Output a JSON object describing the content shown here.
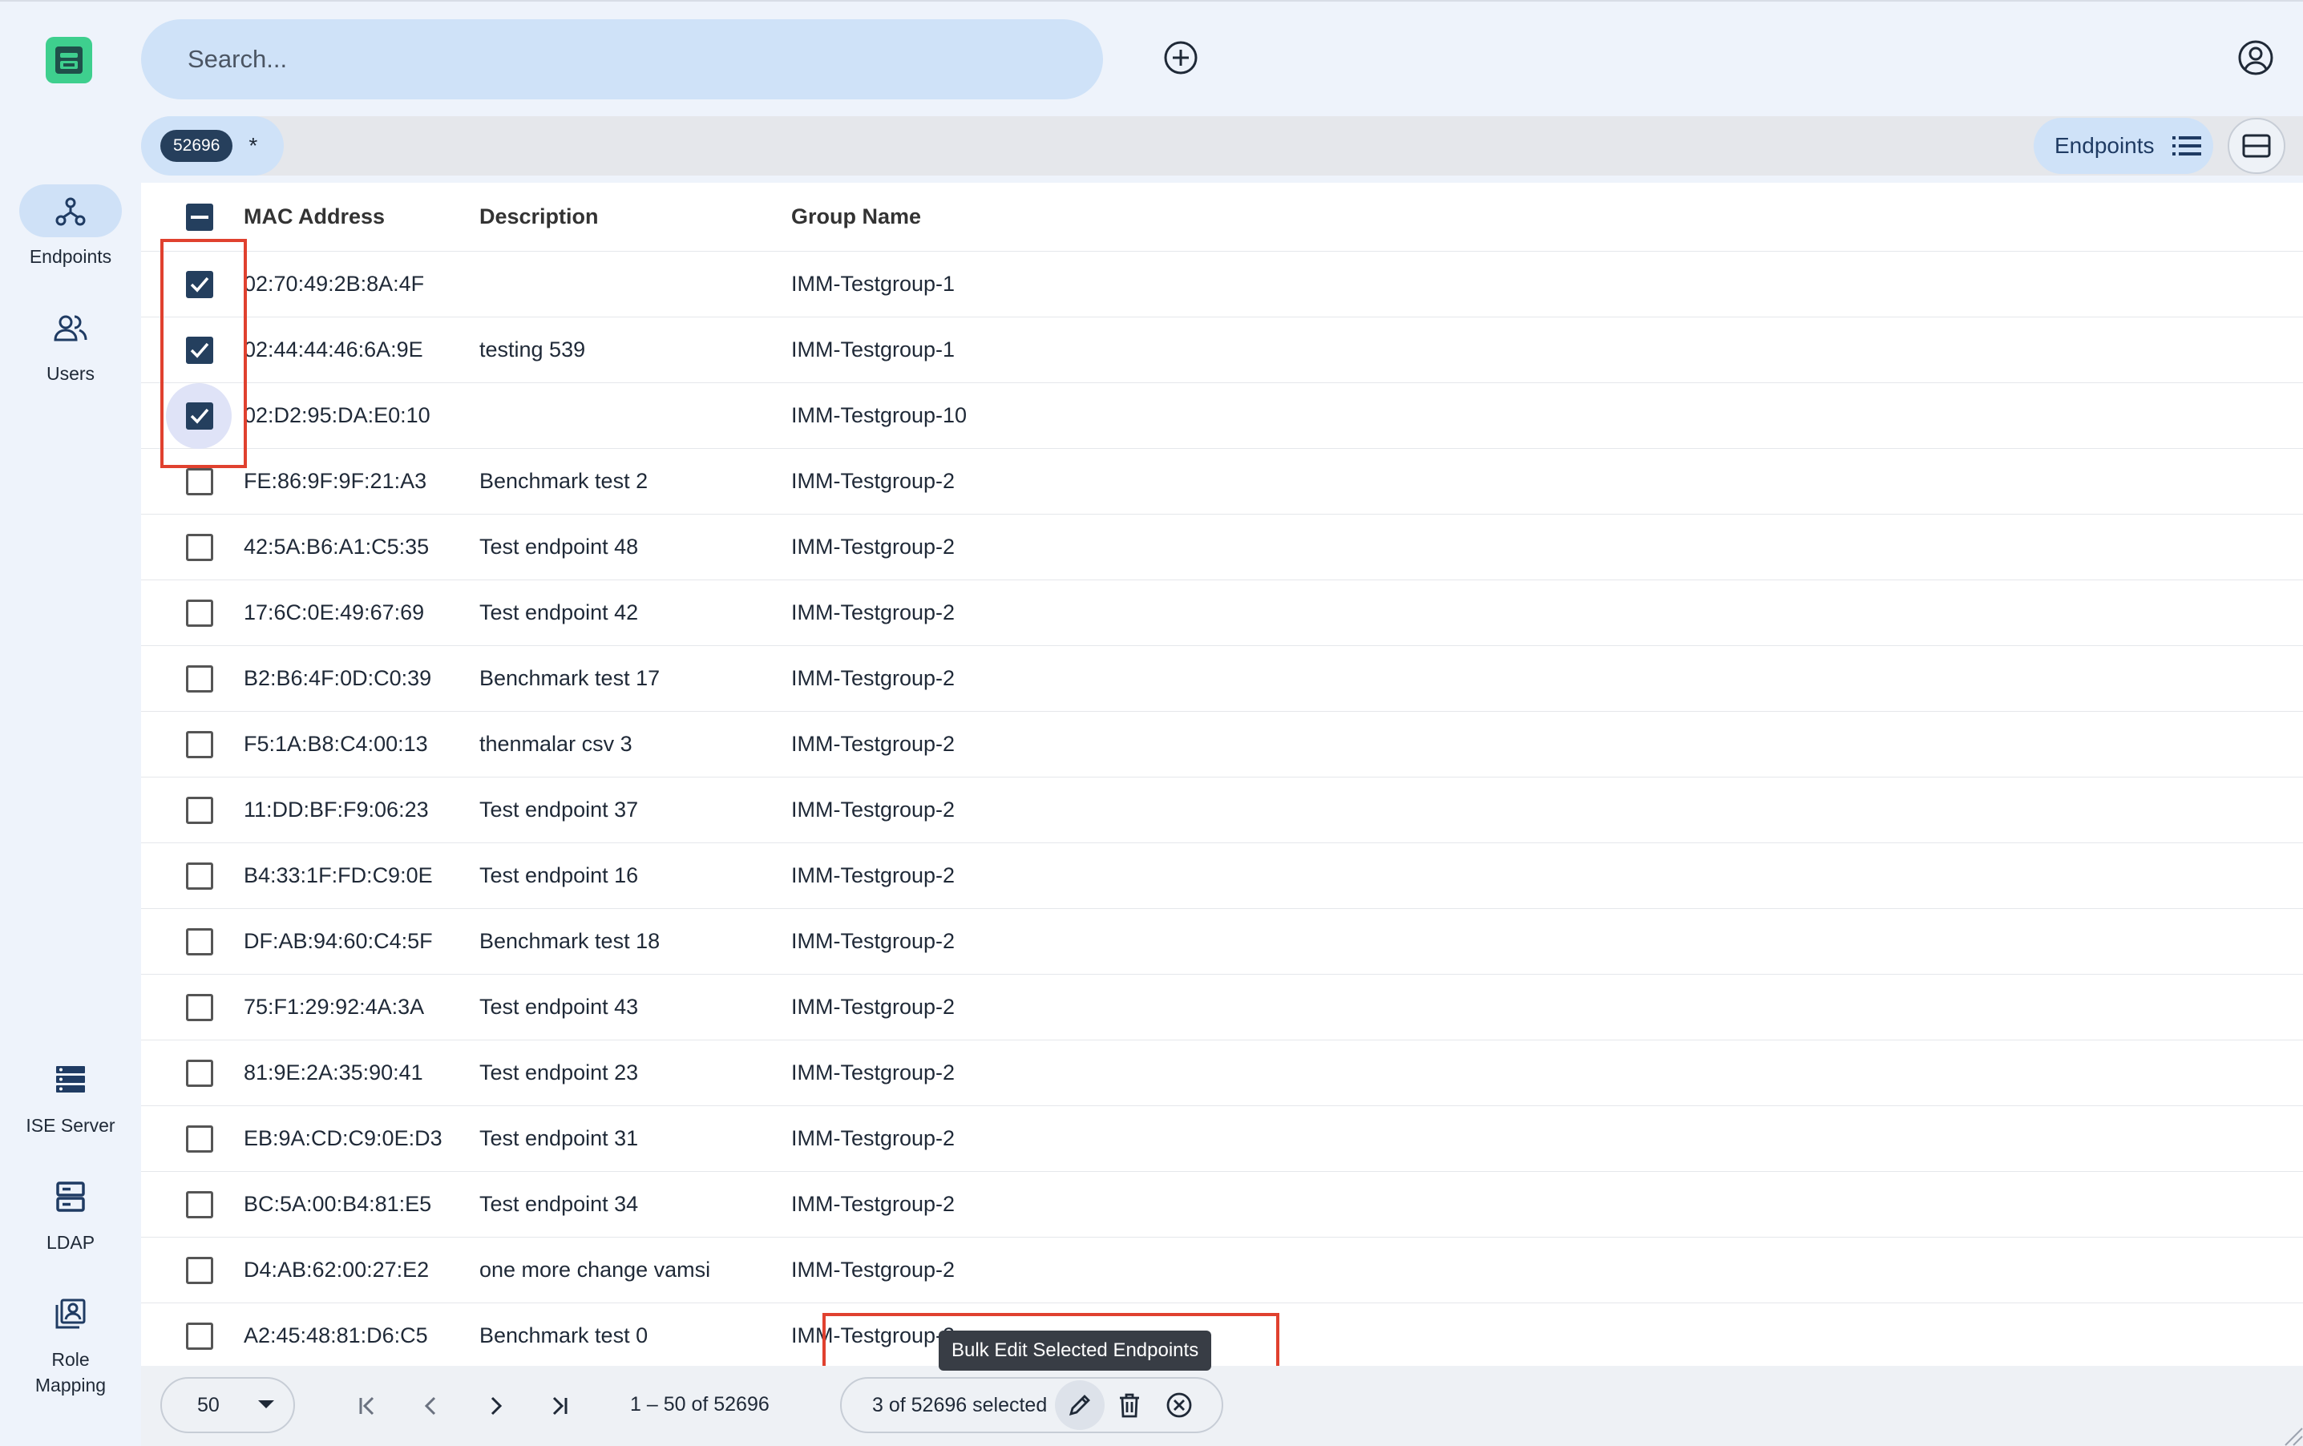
{
  "search": {
    "placeholder": "Search..."
  },
  "sidebar": {
    "items": [
      {
        "label": "Endpoints",
        "icon": "endpoints-icon",
        "active": true
      },
      {
        "label": "Users",
        "icon": "users-icon",
        "active": false
      },
      {
        "label": "ISE Server",
        "icon": "ise-server-icon",
        "active": false
      },
      {
        "label": "LDAP",
        "icon": "ldap-icon",
        "active": false
      },
      {
        "label": "Role Mapping",
        "icon": "role-mapping-icon",
        "active": false
      }
    ]
  },
  "filters": {
    "count_chip": "52696",
    "wildcard": "*"
  },
  "view": {
    "label": "Endpoints"
  },
  "table": {
    "columns": [
      "MAC Address",
      "Description",
      "Group Name"
    ],
    "header_checkbox": "indeterminate",
    "rows": [
      {
        "mac": "02:70:49:2B:8A:4F",
        "description": "",
        "group": "IMM-Testgroup-1",
        "checked": true
      },
      {
        "mac": "02:44:44:46:6A:9E",
        "description": "testing 539",
        "group": "IMM-Testgroup-1",
        "checked": true
      },
      {
        "mac": "02:D2:95:DA:E0:10",
        "description": "",
        "group": "IMM-Testgroup-10",
        "checked": true
      },
      {
        "mac": "FE:86:9F:9F:21:A3",
        "description": "Benchmark test 2",
        "group": "IMM-Testgroup-2",
        "checked": false
      },
      {
        "mac": "42:5A:B6:A1:C5:35",
        "description": "Test endpoint 48",
        "group": "IMM-Testgroup-2",
        "checked": false
      },
      {
        "mac": "17:6C:0E:49:67:69",
        "description": "Test endpoint 42",
        "group": "IMM-Testgroup-2",
        "checked": false
      },
      {
        "mac": "B2:B6:4F:0D:C0:39",
        "description": "Benchmark test 17",
        "group": "IMM-Testgroup-2",
        "checked": false
      },
      {
        "mac": "F5:1A:B8:C4:00:13",
        "description": "thenmalar csv 3",
        "group": "IMM-Testgroup-2",
        "checked": false
      },
      {
        "mac": "11:DD:BF:F9:06:23",
        "description": "Test endpoint 37",
        "group": "IMM-Testgroup-2",
        "checked": false
      },
      {
        "mac": "B4:33:1F:FD:C9:0E",
        "description": "Test endpoint 16",
        "group": "IMM-Testgroup-2",
        "checked": false
      },
      {
        "mac": "DF:AB:94:60:C4:5F",
        "description": "Benchmark test 18",
        "group": "IMM-Testgroup-2",
        "checked": false
      },
      {
        "mac": "75:F1:29:92:4A:3A",
        "description": "Test endpoint 43",
        "group": "IMM-Testgroup-2",
        "checked": false
      },
      {
        "mac": "81:9E:2A:35:90:41",
        "description": "Test endpoint 23",
        "group": "IMM-Testgroup-2",
        "checked": false
      },
      {
        "mac": "EB:9A:CD:C9:0E:D3",
        "description": "Test endpoint 31",
        "group": "IMM-Testgroup-2",
        "checked": false
      },
      {
        "mac": "BC:5A:00:B4:81:E5",
        "description": "Test endpoint 34",
        "group": "IMM-Testgroup-2",
        "checked": false
      },
      {
        "mac": "D4:AB:62:00:27:E2",
        "description": "one more change vamsi",
        "group": "IMM-Testgroup-2",
        "checked": false
      },
      {
        "mac": "A2:45:48:81:D6:C5",
        "description": "Benchmark test 0",
        "group": "IMM-Testgroup-2",
        "checked": false
      }
    ]
  },
  "paginator": {
    "page_size": "50",
    "range_label": "1 – 50 of 52696"
  },
  "selection": {
    "summary": "3 of 52696 selected",
    "tooltip": "Bulk Edit Selected Endpoints"
  },
  "colors": {
    "accent": "#243f5e",
    "highlight": "#e0412f",
    "logo": "#3ecf8e"
  }
}
